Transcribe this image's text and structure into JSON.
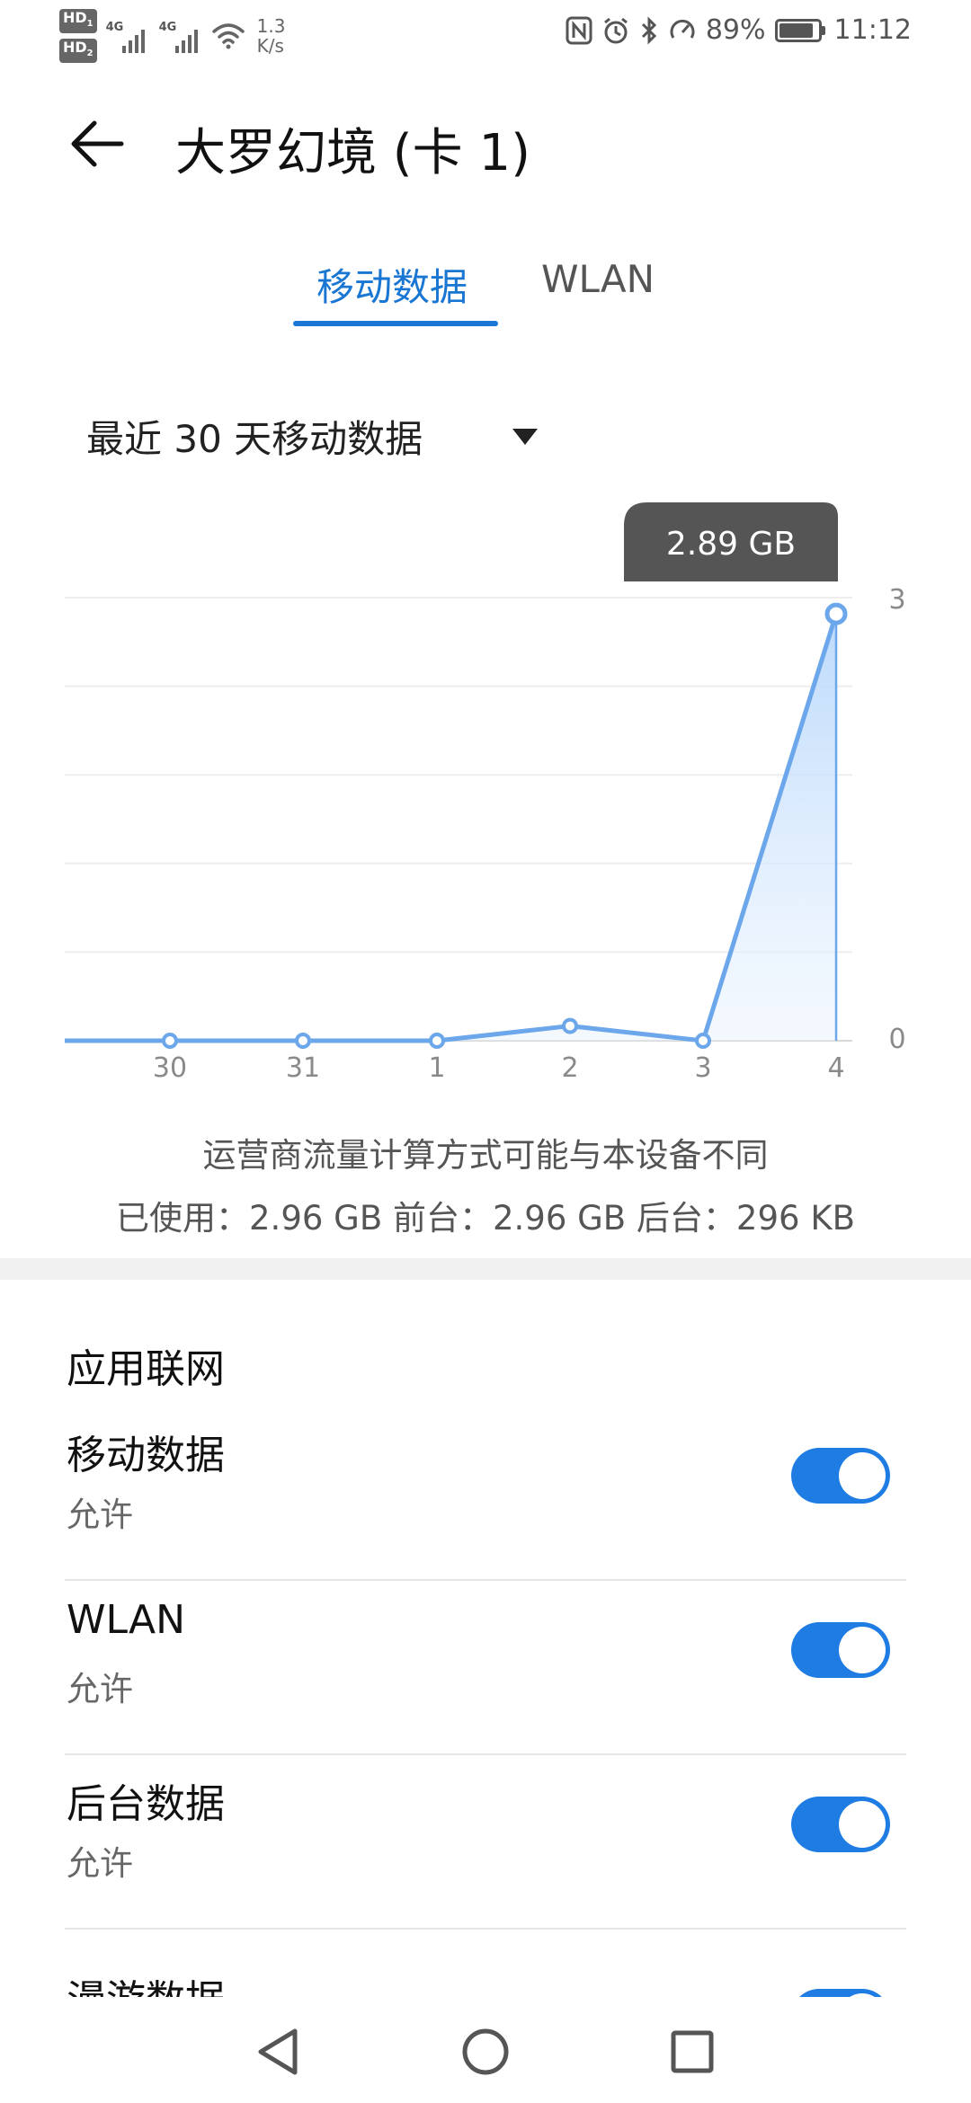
{
  "status_bar": {
    "hd1": "HD",
    "hd1_sub": "1",
    "hd2": "HD",
    "hd2_sub": "2",
    "net1": "4G",
    "net2": "4G",
    "speed_value": "1.3",
    "speed_unit": "K/s",
    "battery": "89%",
    "time": "11:12",
    "icons": [
      "nfc-icon",
      "alarm-icon",
      "bluetooth-icon",
      "data-saver-icon"
    ]
  },
  "header": {
    "title": "大罗幻境 (卡 1)"
  },
  "tabs": [
    {
      "label": "移动数据",
      "active": true
    },
    {
      "label": "WLAN",
      "active": false
    }
  ],
  "period": {
    "label": "最近 30 天移动数据"
  },
  "chart_data": {
    "type": "area",
    "x": [
      "",
      "30",
      "31",
      "1",
      "2",
      "3",
      "4"
    ],
    "values": [
      0,
      0,
      0,
      0,
      0.1,
      0,
      2.89
    ],
    "ylim": [
      0,
      3
    ],
    "y_ticks": [
      "3",
      "0"
    ],
    "tooltip": "2.89 GB",
    "grid": true,
    "accent": "#6ba7ea"
  },
  "note": "运营商流量计算方式可能与本设备不同",
  "usage": "已使用：2.96 GB  前台：2.96 GB  后台：296 KB",
  "section": {
    "title": "应用联网"
  },
  "rows": [
    {
      "title": "移动数据",
      "subtitle": "允许",
      "enabled": true
    },
    {
      "title": "WLAN",
      "subtitle": "允许",
      "enabled": true
    },
    {
      "title": "后台数据",
      "subtitle": "允许",
      "enabled": true
    },
    {
      "title": "漫游数据",
      "subtitle": "",
      "enabled": true
    }
  ],
  "colors": {
    "accent": "#1976d2",
    "toggle_on": "#1e7ce3"
  }
}
